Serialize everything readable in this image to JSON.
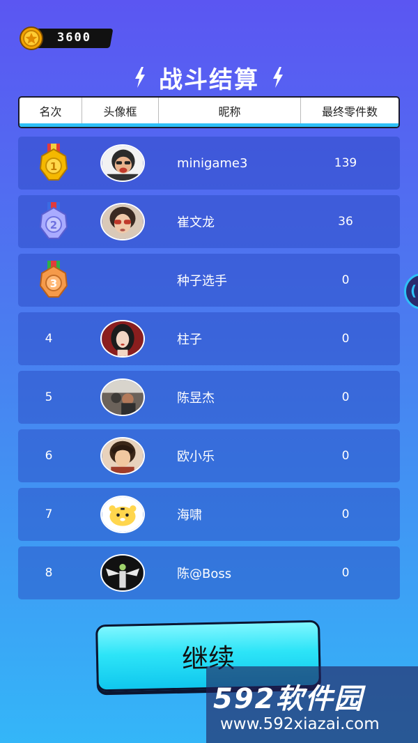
{
  "coins": {
    "value": "3600"
  },
  "title": "战斗结算",
  "columns": [
    "名次",
    "头像框",
    "昵称",
    "最终零件数"
  ],
  "rows": [
    {
      "rank": "1",
      "medal": "gold",
      "nick": "minigame3",
      "score": "139",
      "avatar": "cartoon-face-avatar"
    },
    {
      "rank": "2",
      "medal": "silver",
      "nick": "崔文龙",
      "score": "36",
      "avatar": "sunglasses-avatar"
    },
    {
      "rank": "3",
      "medal": "bronze",
      "nick": "种子选手",
      "score": "0",
      "avatar": ""
    },
    {
      "rank": "4",
      "medal": "",
      "nick": "柱子",
      "score": "0",
      "avatar": "girl-portrait-avatar"
    },
    {
      "rank": "5",
      "medal": "",
      "nick": "陈昱杰",
      "score": "0",
      "avatar": "group-photo-avatar"
    },
    {
      "rank": "6",
      "medal": "",
      "nick": "欧小乐",
      "score": "0",
      "avatar": "anime-boy-avatar"
    },
    {
      "rank": "7",
      "medal": "",
      "nick": "海啸",
      "score": "0",
      "avatar": "tiger-avatar"
    },
    {
      "rank": "8",
      "medal": "",
      "nick": "陈@Boss",
      "score": "0",
      "avatar": "winged-figure-avatar"
    }
  ],
  "continue_label": "继续",
  "watermark": {
    "logo": "592软件园",
    "url": "www.592xiazai.com"
  },
  "colors": {
    "bg_top": "#5b56f2",
    "bg_bottom": "#34b6f8",
    "button": "#2de4f7",
    "gold": "#f5b800",
    "silver": "#8d8ff0",
    "bronze": "#f59a4a"
  }
}
